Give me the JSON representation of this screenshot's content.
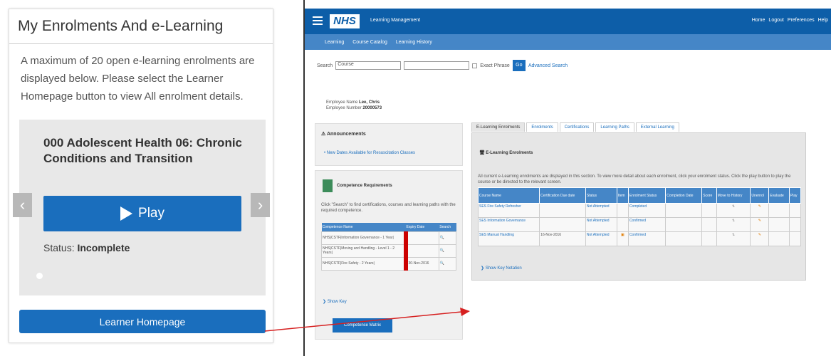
{
  "widget": {
    "title": "My Enrolments And e-Learning",
    "intro": "A maximum of 20 open e-learning enrolments are displayed below. Please select the Learner Homepage button to view All enrolment details.",
    "course_title": "000 Adolescent Health 06: Chronic Conditions and Transition",
    "play_label": "Play",
    "status_label": "Status:",
    "status_value": "Incomplete",
    "prev_icon": "‹",
    "next_icon": "›",
    "learner_homepage_label": "Learner Homepage"
  },
  "lms": {
    "logo": "NHS",
    "app_title": "Learning Management",
    "top_links": [
      "Home",
      "Logout",
      "Preferences",
      "Help"
    ],
    "nav": [
      "Learning",
      "Course Catalog",
      "Learning History"
    ],
    "search": {
      "label": "Search",
      "select_value": "Course",
      "exact_phrase": "Exact Phrase",
      "go": "Go",
      "advanced": "Advanced Search"
    },
    "employee": {
      "name_label": "Employee Name",
      "name": "Lee, Chris",
      "number_label": "Employee Number",
      "number": "20000573"
    },
    "announcements": {
      "title": "Announcements",
      "item": "New Dates Available for Resuscitation Classes"
    },
    "competence": {
      "title": "Competence Requirements",
      "description": "Click \"Search\" to find certifications, courses and learning paths with the required competence.",
      "headers": [
        "Competence Name",
        "Expiry Date",
        "Search"
      ],
      "rows": [
        [
          "NHS|CSTF|Information Governance - 1 Year|",
          "",
          ""
        ],
        [
          "NHS|CSTF|Moving and Handling - Level 1 - 2 Years|",
          "",
          ""
        ],
        [
          "NHS|CSTF|Fire Safety - 2 Years|",
          "30-Nov-2016",
          ""
        ]
      ],
      "show_key": "Show Key",
      "matrix_button": "Competence Matrix"
    },
    "tabs": [
      "E-Learning Enrolments",
      "Enrolments",
      "Certifications",
      "Learning Paths",
      "External Learning"
    ],
    "elearning": {
      "header": "E-Learning Enrolments",
      "description": "All current e-Learning enrolments are displayed in this section. To view more detail about each enrolment, click your enrolment status. Click the play button to play the course or be directed to the relevant screen.",
      "headers": [
        "Course Name",
        "Certification Due date",
        "Status",
        "Item",
        "Enrolment Status",
        "Completion Date",
        "Score",
        "Move to History",
        "Unenrol",
        "Evaluate",
        "Play"
      ],
      "rows": [
        [
          "SES Fire Safety Refresher",
          "",
          "Not Attempted",
          "",
          "Completed",
          "",
          "",
          "",
          "",
          "",
          ""
        ],
        [
          "SES Information Governance",
          "",
          "Not Attempted",
          "",
          "Confirmed",
          "",
          "",
          "",
          "",
          "",
          ""
        ],
        [
          "SES Manual Handling",
          "16-Nov-2016",
          "Not Attempted",
          "",
          "Confirmed",
          "",
          "",
          "",
          "",
          "",
          ""
        ]
      ],
      "show_key": "Show Key Notation"
    }
  }
}
